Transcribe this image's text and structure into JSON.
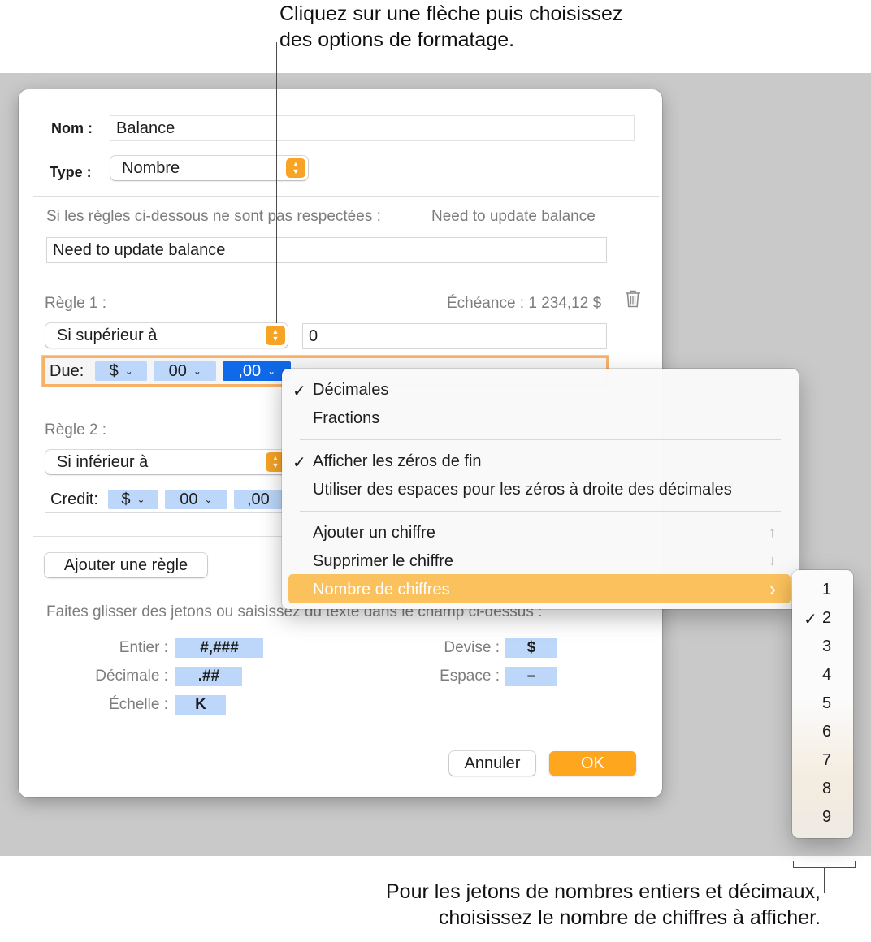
{
  "callouts": {
    "top_line1": "Cliquez sur une flèche puis choisissez",
    "top_line2": "des options de formatage.",
    "bottom_line1": "Pour les jetons de nombres entiers et décimaux,",
    "bottom_line2": "choisissez le nombre de chiffres à afficher."
  },
  "dialog": {
    "name_label": "Nom :",
    "name_value": "Balance",
    "type_label": "Type :",
    "type_value": "Nombre",
    "rules_hint": "Si les règles ci-dessous ne sont pas respectées :",
    "rules_hint_preview": "Need to update balance",
    "message_value": "Need to update balance",
    "rule1": {
      "label": "Règle 1 :",
      "preview": "Échéance : 1 234,12 $",
      "condition": "Si supérieur à",
      "value": "0",
      "format_label": "Due:",
      "tokens": [
        "$",
        "00",
        ",00"
      ]
    },
    "rule2": {
      "label": "Règle 2 :",
      "condition": "Si inférieur à",
      "format_label": "Credit:",
      "tokens": [
        "$",
        "00",
        ",00"
      ]
    },
    "add_rule_button": "Ajouter une règle",
    "drag_hint": "Faites glisser des jetons ou saisissez du texte dans le champ ci-dessus :",
    "palette": {
      "integer_label": "Entier :",
      "integer_token": "#,###",
      "decimal_label": "Décimale :",
      "decimal_token": ".##",
      "scale_label": "Échelle :",
      "scale_token": "K",
      "currency_label": "Devise :",
      "currency_token": "$",
      "space_label": "Espace :",
      "space_token": "–"
    },
    "cancel_button": "Annuler",
    "ok_button": "OK"
  },
  "menu": {
    "items": [
      {
        "label": "Décimales",
        "checked": true
      },
      {
        "label": "Fractions",
        "checked": false
      },
      {
        "label": "Afficher les zéros de fin",
        "checked": true
      },
      {
        "label": "Utiliser des espaces pour les zéros à droite des décimales",
        "checked": false
      },
      {
        "label": "Ajouter un chiffre",
        "shortcut": "↑"
      },
      {
        "label": "Supprimer le chiffre",
        "shortcut": "↓"
      },
      {
        "label": "Nombre de chiffres",
        "submenu": true,
        "highlighted": true
      }
    ],
    "checkmark": "✓",
    "submenu_arrow": "›"
  },
  "submenu": {
    "digits": [
      "1",
      "2",
      "3",
      "4",
      "5",
      "6",
      "7",
      "8",
      "9"
    ],
    "selected": "2"
  },
  "colors": {
    "accent_orange": "#fda61e",
    "token_blue": "#bcd7fa",
    "token_selected": "#1069e8",
    "menu_highlight": "#fbc15c"
  }
}
